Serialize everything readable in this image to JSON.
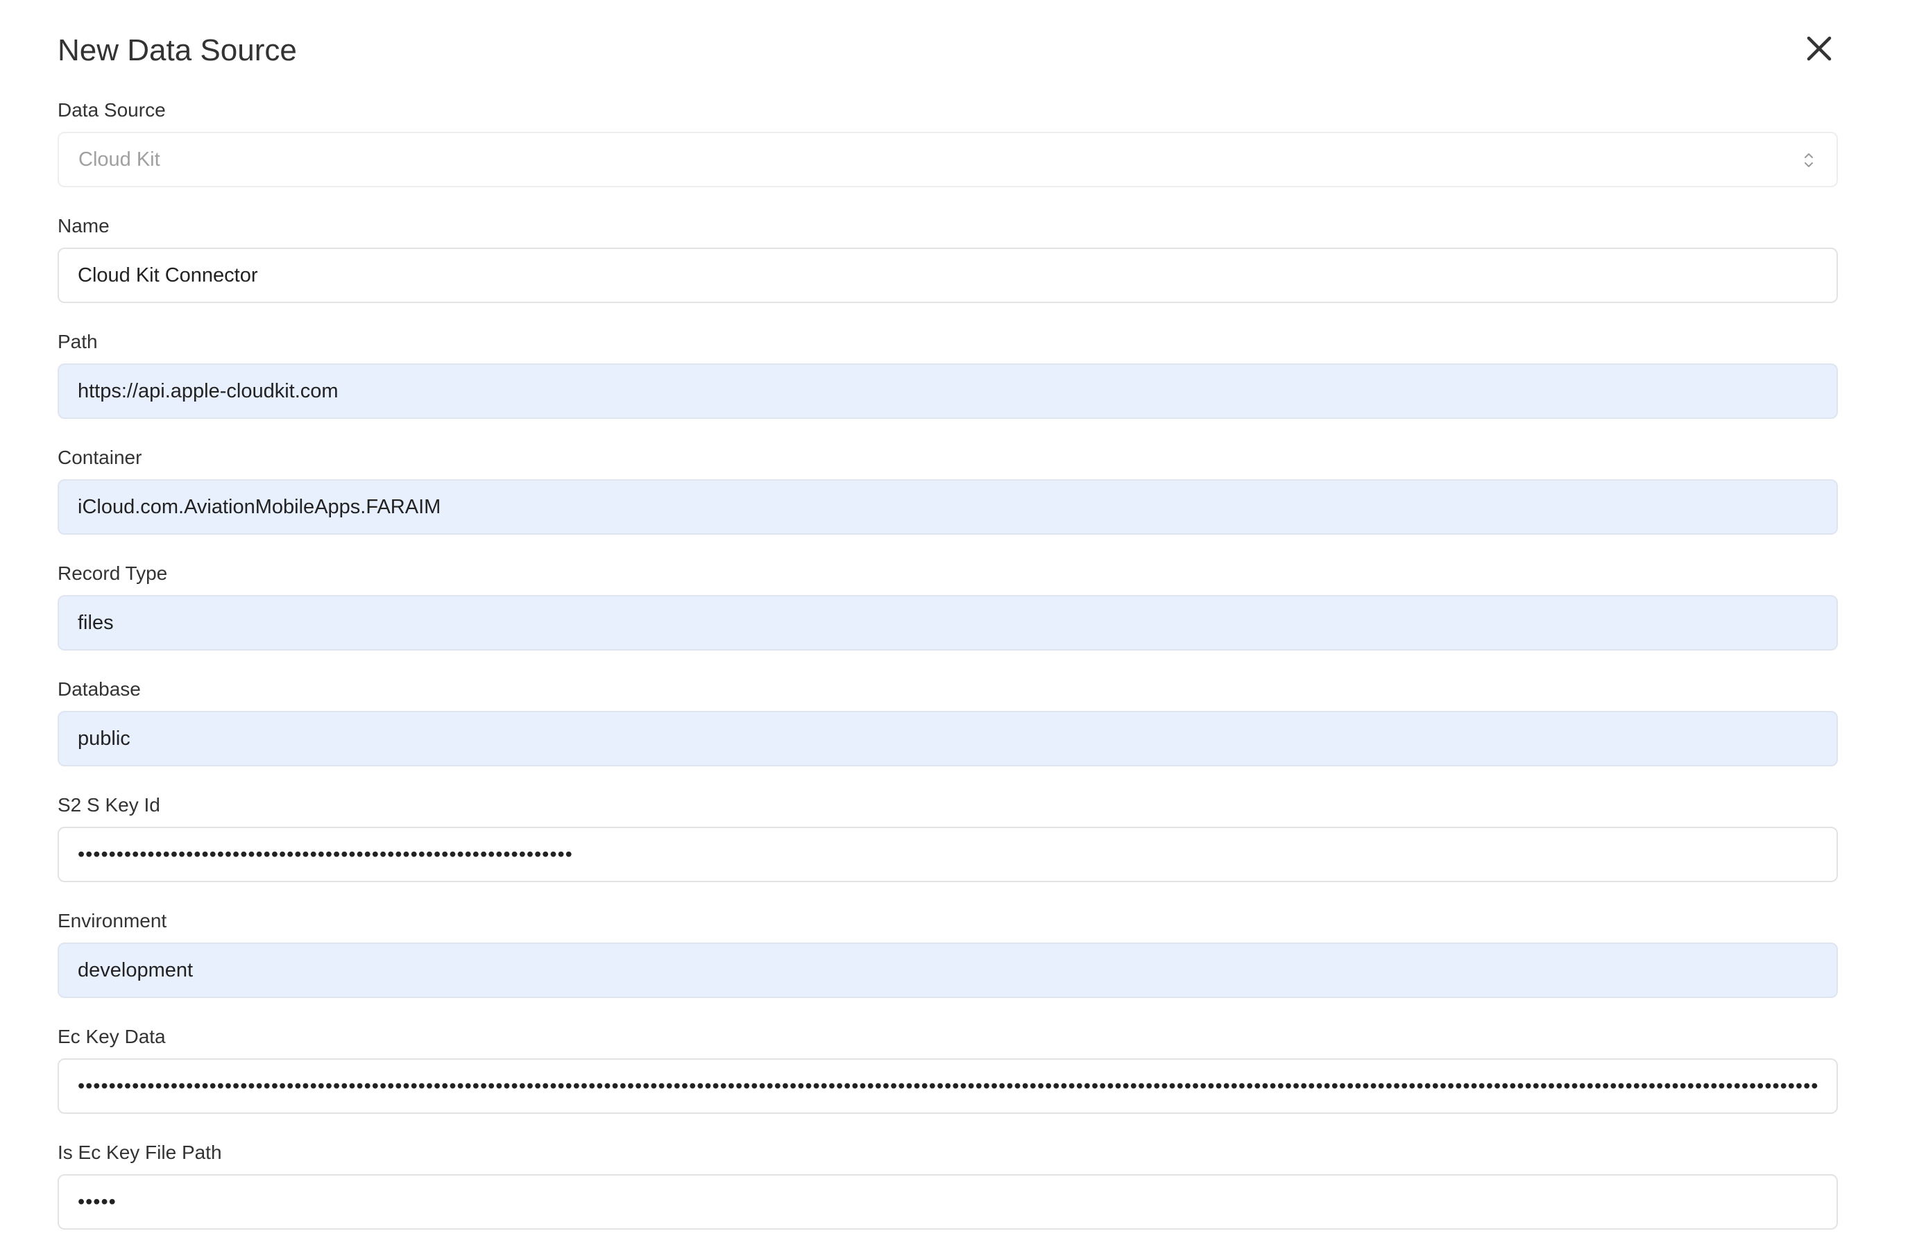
{
  "dialog": {
    "title": "New Data Source",
    "close_icon": "close-icon"
  },
  "fields": {
    "data_source": {
      "label": "Data Source",
      "value": "Cloud Kit",
      "disabled": true,
      "icon": "chevron-up-down-icon"
    },
    "name": {
      "label": "Name",
      "value": "Cloud Kit Connector"
    },
    "path": {
      "label": "Path",
      "value": "https://api.apple-cloudkit.com"
    },
    "container": {
      "label": "Container",
      "value": "iCloud.com.AviationMobileApps.FARAIM"
    },
    "record_type": {
      "label": "Record Type",
      "value": "files"
    },
    "database": {
      "label": "Database",
      "value": "public"
    },
    "s2s_key_id": {
      "label": "S2 S Key Id",
      "value": "••••••••••••••••••••••••••••••••••••••••••••••••••••••••••••••••"
    },
    "environment": {
      "label": "Environment",
      "value": "development"
    },
    "ec_key_data": {
      "label": "Ec Key Data",
      "value": "•••••••••••••••••••••••••••••••••••••••••••••••••••••••••••••••••••••••••••••••••••••••••••••••••••••••••••••••••••••••••••••••••••••••••••••••••••••••••••••••••••••••••••••••••••••••••••••••••••••••••••••••••••••••••••••••••••••••••••••••••••••••••••••••••••••••••••••••••••••••••••••••••••••••••••••••••••••••••••••••••••••••••••••••••••••••••••••••••••••••••••••••••••••••••••••••••••"
    },
    "is_ec_key_file_path": {
      "label": "Is Ec Key File Path",
      "value": "•••••"
    }
  },
  "colors": {
    "autofill_bg": "#e8f0fe",
    "border": "#e3e3e3",
    "text": "#333333",
    "placeholder": "#a0a0a0"
  }
}
